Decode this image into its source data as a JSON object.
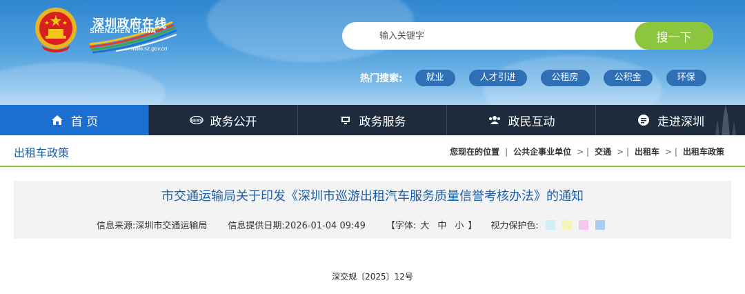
{
  "header": {
    "logo_cn": "深圳政府在线",
    "logo_en": "SHENZHEN CHINA",
    "logo_url": "www.sz.gov.cn"
  },
  "search": {
    "placeholder": "输入关键字",
    "button_label": "搜一下"
  },
  "hot_search": {
    "label": "热门搜索:",
    "tags": [
      "就业",
      "人才引进",
      "公租房",
      "公积金",
      "环保"
    ]
  },
  "nav": {
    "items": [
      {
        "label": "首 页",
        "icon": "home-icon"
      },
      {
        "label": "政务公开",
        "icon": "news-icon"
      },
      {
        "label": "政务服务",
        "icon": "monitor-icon"
      },
      {
        "label": "政民互动",
        "icon": "users-icon"
      },
      {
        "label": "走进深圳",
        "icon": "info-bubble-icon"
      }
    ],
    "active_color": "#1a6fd1"
  },
  "breadcrumb": {
    "section_title": "出租车政策",
    "prefix": "您现在的位置",
    "items": [
      "公共企事业单位",
      "交通",
      "出租车",
      "出租车政策"
    ]
  },
  "article": {
    "title": "市交通运输局关于印发《深圳市巡游出租汽车服务质量信誉考核办法》的通知",
    "source_label": "信息来源:深圳市交通运输局",
    "date_label": "信息提供日期:2026-01-04 09:49",
    "font_label_open": "【字体:",
    "font_sizes": [
      "大",
      "中",
      "小"
    ],
    "font_label_close": "】",
    "vision_label": "视力保护色:",
    "vision_colors": [
      "#cdeff5",
      "#f5f3b8",
      "#f5c7ef",
      "#a8ccf2"
    ],
    "doc_number": "深交规〔2025〕12号"
  }
}
